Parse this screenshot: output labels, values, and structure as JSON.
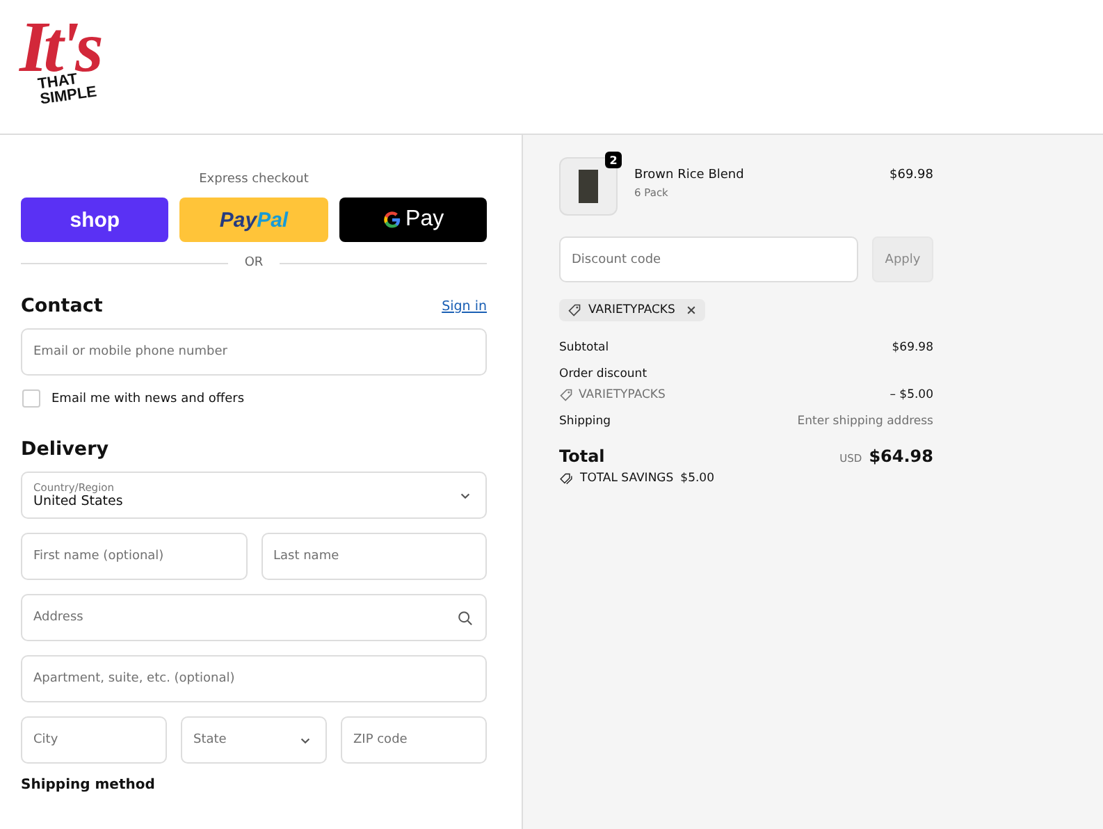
{
  "logo": {
    "big": "It's",
    "line1": "THAT",
    "line2": "SIMPLE"
  },
  "express": {
    "title": "Express checkout",
    "buttons": [
      {
        "kind": "shop",
        "label": "shop"
      },
      {
        "kind": "paypal",
        "label": "Pay",
        "label2": "Pal"
      },
      {
        "kind": "gpay",
        "label": "Pay"
      }
    ],
    "divider": "OR"
  },
  "contact": {
    "heading": "Contact",
    "link": "Sign in",
    "email_placeholder": "Email or mobile phone number",
    "newsletter": {
      "label": "Email me with news and offers",
      "checked": false
    }
  },
  "delivery": {
    "heading": "Delivery",
    "rows": [
      [
        {
          "kind": "select",
          "label": "Country/Region",
          "value": "United States"
        }
      ],
      [
        {
          "kind": "text",
          "placeholder": "First name (optional)"
        },
        {
          "kind": "text",
          "placeholder": "Last name"
        }
      ],
      [
        {
          "kind": "search",
          "placeholder": "Address"
        }
      ],
      [
        {
          "kind": "text",
          "placeholder": "Apartment, suite, etc. (optional)"
        }
      ],
      [
        {
          "kind": "text",
          "placeholder": "City"
        },
        {
          "kind": "select",
          "placeholder": "State"
        },
        {
          "kind": "text",
          "placeholder": "ZIP code"
        }
      ]
    ]
  },
  "shipping_method": {
    "heading": "Shipping method"
  },
  "summary": {
    "item": {
      "quantity": "2",
      "name": "Brown Rice Blend",
      "variant": "6 Pack",
      "price": "$69.98"
    },
    "discount": {
      "placeholder": "Discount code",
      "button": "Apply",
      "applied_tag": "VARIETYPACKS"
    },
    "subtotal": {
      "label": "Subtotal",
      "value": "$69.98"
    },
    "order_discount": {
      "label": "Order discount",
      "code": "VARIETYPACKS",
      "value": "– $5.00"
    },
    "shipping": {
      "label": "Shipping",
      "value": "Enter shipping address"
    },
    "total": {
      "label": "Total",
      "currency": "USD",
      "value": "$64.98"
    },
    "savings": {
      "label": "TOTAL SAVINGS",
      "value": "$5.00"
    }
  }
}
